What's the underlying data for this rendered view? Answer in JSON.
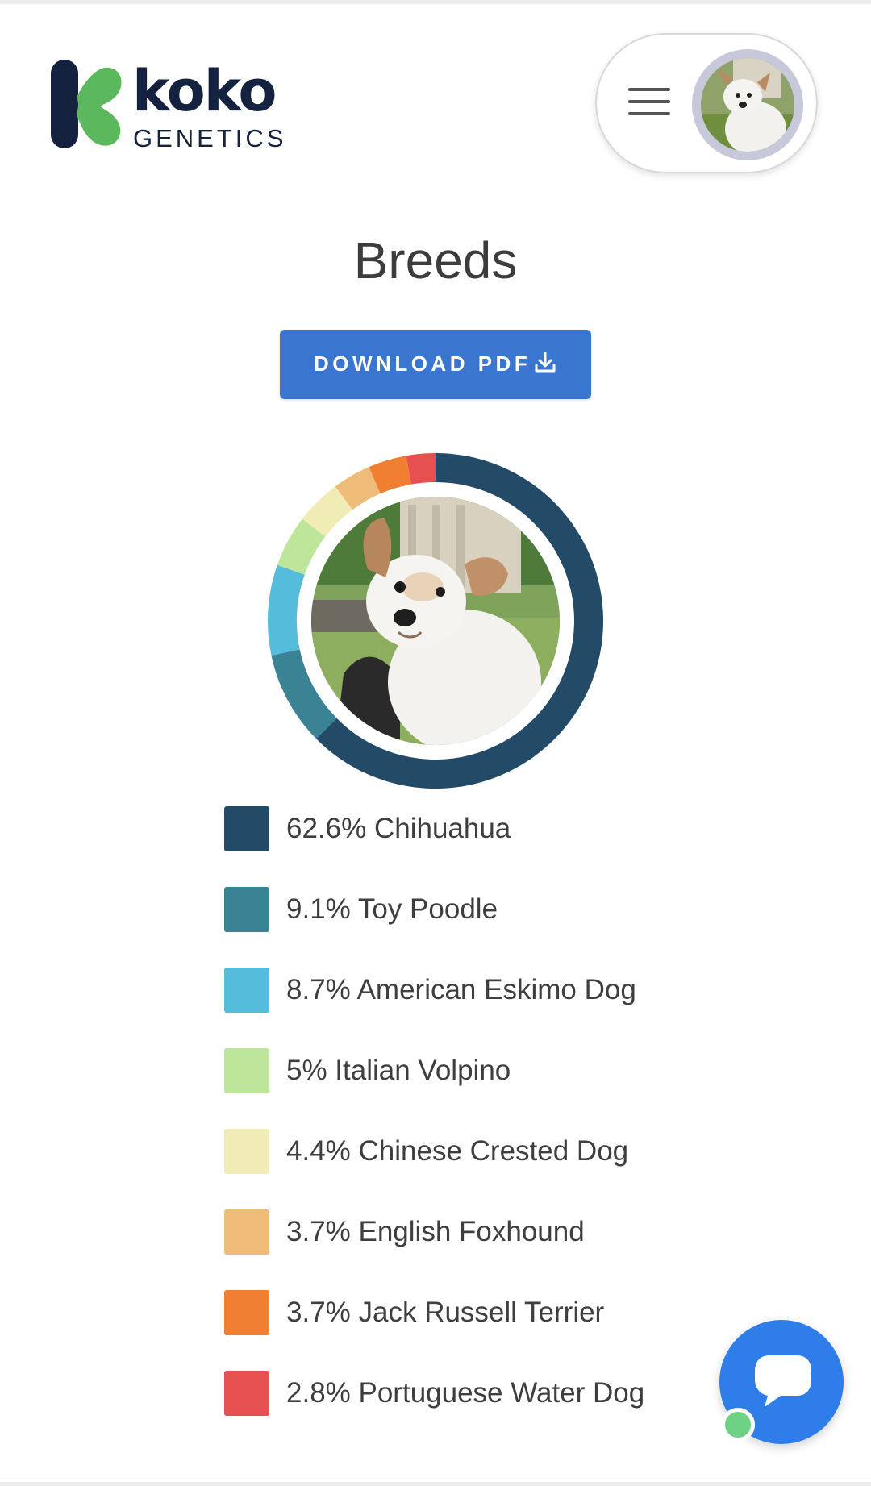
{
  "brand": {
    "name": "koko",
    "subtitle": "GENETICS",
    "colors": {
      "navy": "#14213f",
      "green": "#5cb85c"
    }
  },
  "header": {
    "menu_icon": "hamburger-menu-icon",
    "avatar_icon": "dog-avatar"
  },
  "page": {
    "title": "Breeds",
    "download_label": "DOWNLOAD PDF",
    "download_icon": "download-icon",
    "accent": "#3a76cf"
  },
  "chart_data": {
    "type": "pie",
    "variant": "donut",
    "unit": "%",
    "slices": [
      {
        "label": "62.6% Chihuahua",
        "name": "Chihuahua",
        "value": 62.6,
        "color": "#234a66"
      },
      {
        "label": "9.1% Toy Poodle",
        "name": "Toy Poodle",
        "value": 9.1,
        "color": "#3a8394"
      },
      {
        "label": "8.7% American Eskimo Dog",
        "name": "American Eskimo Dog",
        "value": 8.7,
        "color": "#55bddb"
      },
      {
        "label": "5% Italian Volpino",
        "name": "Italian Volpino",
        "value": 5,
        "color": "#bde69b"
      },
      {
        "label": "4.4% Chinese Crested Dog",
        "name": "Chinese Crested Dog",
        "value": 4.4,
        "color": "#f1ebb5"
      },
      {
        "label": "3.7% English Foxhound",
        "name": "English Foxhound",
        "value": 3.7,
        "color": "#eebb79"
      },
      {
        "label": "3.7% Jack Russell Terrier",
        "name": "Jack Russell Terrier",
        "value": 3.7,
        "color": "#f17f32"
      },
      {
        "label": "2.8% Portuguese Water Dog",
        "name": "Portuguese Water Dog",
        "value": 2.8,
        "color": "#e65050"
      }
    ]
  },
  "chat": {
    "icon": "chat-bubble-icon",
    "status": "online",
    "color": "#2f7de8",
    "status_color": "#6dd283"
  }
}
